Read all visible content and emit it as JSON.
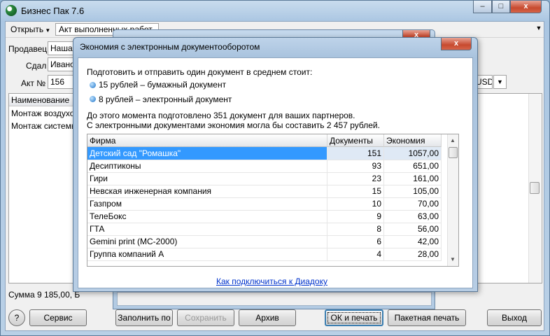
{
  "app": {
    "title": "Бизнес Пак 7.6",
    "window_controls": {
      "minimize": "–",
      "maximize": "□",
      "close": "x"
    }
  },
  "toolbar": {
    "open_label": "Открыть",
    "document_type": "Акт выполненных работ"
  },
  "form": {
    "seller_label": "Продавец",
    "seller_value": "Наша",
    "handed_label": "Сдал",
    "handed_value": "Ивано",
    "act_label": "Акт №",
    "act_value": "156",
    "currency_value": "USD"
  },
  "items_grid": {
    "column_name": "Наименование",
    "rows": [
      "Монтаж воздухов",
      "Монтаж системы"
    ]
  },
  "status": {
    "sum_text": "Сумма 9 185,00, Б"
  },
  "bottom_buttons": {
    "help": "?",
    "service": "Сервис",
    "fill": "Заполнить по",
    "save": "Сохранить",
    "archive": "Архив",
    "ok_print": "ОК и печать",
    "batch_print": "Пакетная печать",
    "exit": "Выход"
  },
  "dialog": {
    "title": "Экономия с электронным документооборотом",
    "intro": "Подготовить и отправить один документ в среднем стоит:",
    "paper_cost": "15 рублей – бумажный документ",
    "electronic_cost": "8 рублей – электронный документ",
    "summary_line1": "До этого момента подготовлено 351 документ для ваших партнеров.",
    "summary_line2": "С электронными документами экономия могла бы составить 2 457 рублей.",
    "columns": {
      "company": "Фирма",
      "documents": "Документы",
      "savings": "Экономия"
    },
    "rows": [
      {
        "company": "Детский сад \"Ромашка\"",
        "documents": "151",
        "savings": "1057,00"
      },
      {
        "company": "Десиптиконы",
        "documents": "93",
        "savings": "651,00"
      },
      {
        "company": "Гири",
        "documents": "23",
        "savings": "161,00"
      },
      {
        "company": "Невская инженерная компания",
        "documents": "15",
        "savings": "105,00"
      },
      {
        "company": "Газпром",
        "documents": "10",
        "savings": "70,00"
      },
      {
        "company": "ТелеБокс",
        "documents": "9",
        "savings": "63,00"
      },
      {
        "company": "ГТА",
        "documents": "8",
        "savings": "56,00"
      },
      {
        "company": "Gemini print (MC-2000)",
        "documents": "6",
        "savings": "42,00"
      },
      {
        "company": "Группа компаний А",
        "documents": "4",
        "savings": "28,00"
      }
    ],
    "selected_row": 0,
    "link": "Как подключиться к Диадоку",
    "close_glyph": "x"
  }
}
